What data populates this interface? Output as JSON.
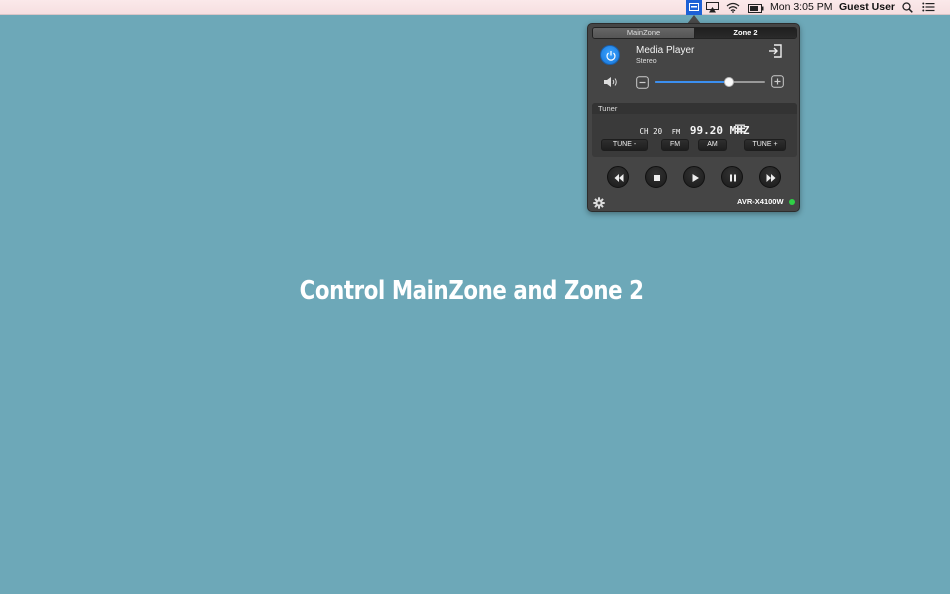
{
  "menubar": {
    "clock": "Mon 3:05 PM",
    "user": "Guest User",
    "icons": [
      "avr-app-icon",
      "airplay-icon",
      "wifi-icon",
      "battery-icon",
      "spotlight-search-icon",
      "notification-list-icon"
    ]
  },
  "panel": {
    "tabs": [
      {
        "label": "MainZone",
        "selected": false
      },
      {
        "label": "Zone 2",
        "selected": true
      }
    ],
    "source": {
      "name": "Media Player",
      "mode": "Stereo"
    },
    "volume": {
      "level": 0.67
    },
    "tuner": {
      "title": "Tuner",
      "channel": "CH 20",
      "band": "FM",
      "frequency": "99.20 MHZ",
      "buttons": {
        "tune_down": "TUNE -",
        "fm": "FM",
        "am": "AM",
        "tune_up": "TUNE +"
      }
    },
    "device": "AVR-X4100W",
    "status_color": "#2fd046",
    "accent": "#1d61d6"
  },
  "headline": "Control MainZone and Zone 2"
}
